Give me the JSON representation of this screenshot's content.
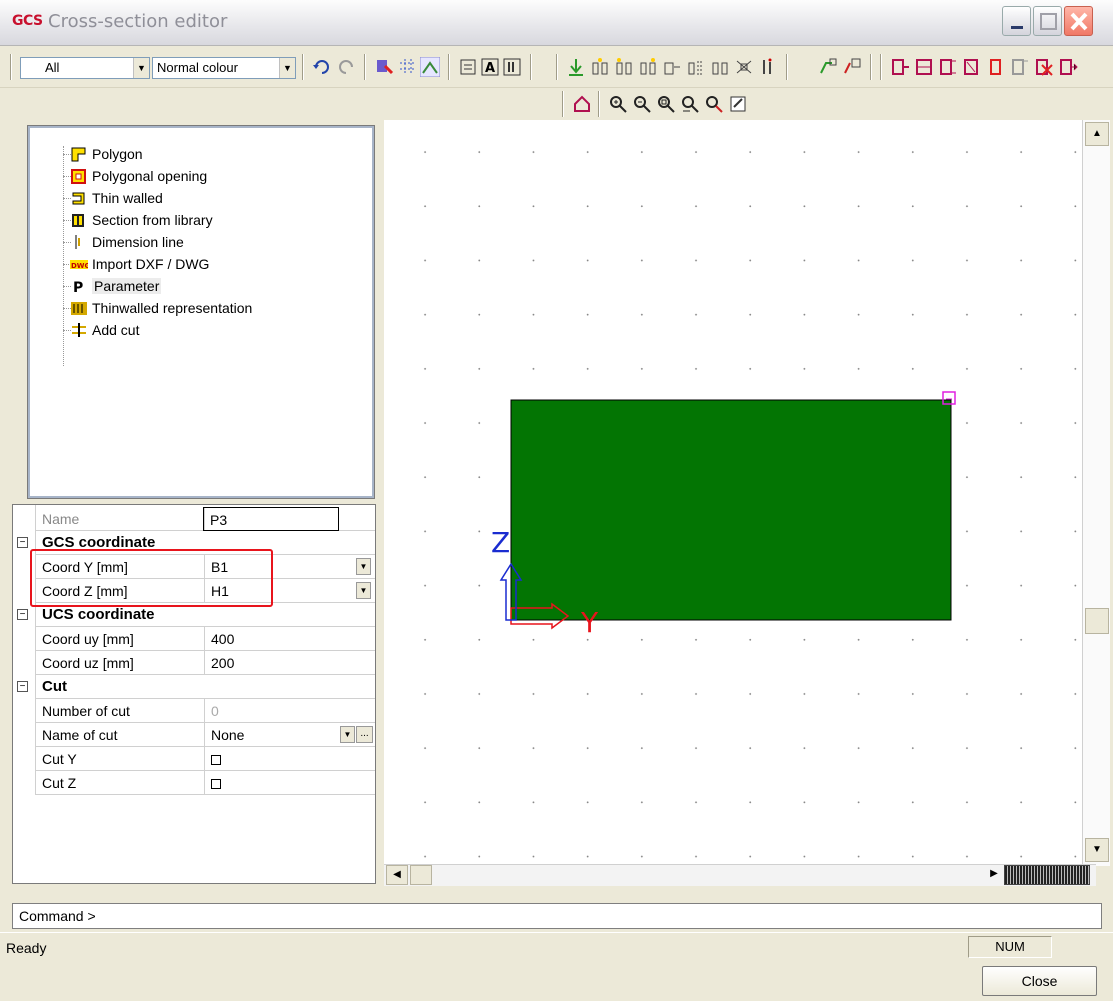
{
  "window": {
    "logo": "GCS",
    "title": "Cross-section editor"
  },
  "toolbar": {
    "filter_combo": "All",
    "colour_combo": "Normal colour"
  },
  "tree": {
    "items": [
      {
        "label": "Polygon",
        "icon": "polygon-icon"
      },
      {
        "label": "Polygonal opening",
        "icon": "polygonal-opening-icon"
      },
      {
        "label": "Thin walled",
        "icon": "thin-walled-icon"
      },
      {
        "label": "Section from library",
        "icon": "library-icon"
      },
      {
        "label": "Dimension line",
        "icon": "dimension-line-icon"
      },
      {
        "label": "Import DXF / DWG",
        "icon": "dwg-icon"
      },
      {
        "label": "Parameter",
        "icon": "parameter-icon",
        "selected": true
      },
      {
        "label": "Thinwalled representation",
        "icon": "thinwalled-representation-icon"
      },
      {
        "label": "Add cut",
        "icon": "add-cut-icon"
      }
    ]
  },
  "properties": {
    "name_label": "Name",
    "name_value": "P3",
    "gcs_heading": "GCS coordinate",
    "coord_y_label": "Coord Y [mm]",
    "coord_y_value": "B1",
    "coord_z_label": "Coord Z [mm]",
    "coord_z_value": "H1",
    "ucs_heading": "UCS coordinate",
    "coord_uy_label": "Coord uy [mm]",
    "coord_uy_value": "400",
    "coord_uz_label": "Coord uz [mm]",
    "coord_uz_value": "200",
    "cut_heading": "Cut",
    "number_of_cut_label": "Number of cut",
    "number_of_cut_value": "0",
    "name_of_cut_label": "Name of cut",
    "name_of_cut_value": "None",
    "cut_y_label": "Cut Y",
    "cut_z_label": "Cut Z"
  },
  "canvas": {
    "axis_z_label": "Z",
    "axis_y_label": "Y",
    "section_color": "#037503",
    "highlight_color": "#e8141c"
  },
  "command": {
    "prompt": "Command >"
  },
  "status": {
    "text": "Ready",
    "num": "NUM"
  },
  "buttons": {
    "close": "Close"
  }
}
